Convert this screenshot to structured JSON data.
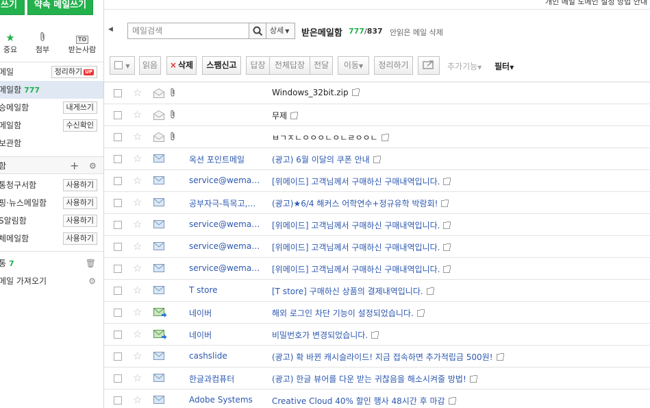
{
  "sidebar": {
    "compose_a": "쓰기",
    "compose_b": "약속 메일쓰기",
    "quick": [
      {
        "label": "중요",
        "icon": "star-icon"
      },
      {
        "label": "첨부",
        "icon": "paperclip-icon"
      },
      {
        "label": "받는사람",
        "icon": "to-icon",
        "icon_text": "TO"
      }
    ],
    "items": [
      {
        "label": "메일",
        "button": "정리하기",
        "badge": "UP"
      },
      {
        "label": "메일함",
        "count": "777"
      },
      {
        "label": "승메일함",
        "button": "내게쓰기"
      },
      {
        "label": "메일함",
        "button": "수신확인"
      },
      {
        "label": "보관함"
      }
    ],
    "folder_header": "함",
    "folders": [
      {
        "label": "통청구서함",
        "button": "사용하기"
      },
      {
        "label": "핑·뉴스메일함",
        "button": "사용하기"
      },
      {
        "label": "S알림함",
        "button": "사용하기"
      },
      {
        "label": "체메일함",
        "button": "사용하기"
      }
    ],
    "trash": {
      "label": "통",
      "count": "7"
    },
    "import": "메일 가져오기"
  },
  "top_strip_text": "개인 메일 도메인 설정 방법 안내",
  "header": {
    "search_placeholder": "메일검색",
    "detail": "상세",
    "title": "받은메일함",
    "unread": "777",
    "total": "837",
    "delete_unread": "안읽은 메일 삭제"
  },
  "toolbar": {
    "read": "읽음",
    "delete": "삭제",
    "spam": "스팸신고",
    "reply": "답장",
    "reply_all": "전체답장",
    "forward": "전달",
    "move": "이동",
    "organize": "정리하기",
    "more": "추가기능",
    "filter": "필터"
  },
  "mails": [
    {
      "sender": "",
      "subject": "Windows_32bit.zip",
      "icon": "envelope-open",
      "attach": true,
      "dark": true
    },
    {
      "sender": "",
      "subject": "무제",
      "icon": "envelope-open",
      "attach": true,
      "dark": true
    },
    {
      "sender": "",
      "subject": "ㅂㄱㅈㄴㅇㅇㅇㄴㅇㄴㄹㅇㅇㄴ",
      "icon": "envelope-open",
      "attach": true,
      "dark": true
    },
    {
      "sender": "옥션 포인트메일",
      "subject": "(광고) 6월 이달의 쿠폰 안내",
      "icon": "envelope"
    },
    {
      "sender": "service@wemade…",
      "subject": "[위메이드] 고객님께서 구매하신 구매내역입니다.",
      "icon": "envelope"
    },
    {
      "sender": "공부자극-특목고,…",
      "subject": "(광고)★6/4 해커스 어학연수+정규유학 박람회!",
      "icon": "envelope"
    },
    {
      "sender": "service@wemade…",
      "subject": "[위메이드] 고객님께서 구매하신 구매내역입니다.",
      "icon": "envelope"
    },
    {
      "sender": "service@wemade…",
      "subject": "[위메이드] 고객님께서 구매하신 구매내역입니다.",
      "icon": "envelope"
    },
    {
      "sender": "service@wemade…",
      "subject": "[위메이드] 고객님께서 구매하신 구매내역입니다.",
      "icon": "envelope"
    },
    {
      "sender": "T store",
      "subject": "[T store] 구매하신 상품의 결제내역입니다.",
      "icon": "envelope"
    },
    {
      "sender": "네이버",
      "subject": "해외 로그인 차단 기능이 설정되었습니다.",
      "icon": "envelope-green"
    },
    {
      "sender": "네이버",
      "subject": "비밀번호가 변경되었습니다.",
      "icon": "envelope-green"
    },
    {
      "sender": "cashslide",
      "subject": "(광고) 확 바뀐 캐시슬라이드! 지금 접속하면 추가적립금 500원!",
      "icon": "envelope"
    },
    {
      "sender": "한글과컴퓨터",
      "subject": "(광고) 한글 뷰어를 다운 받는 귀찮음을 해소시켜줄 방법!",
      "icon": "envelope"
    },
    {
      "sender": "Adobe Systems",
      "subject": "Creative Cloud 40% 할인 행사 48시간 후 마감",
      "icon": "envelope"
    }
  ],
  "colors": {
    "accent": "#23b14d",
    "link": "#2b57b0",
    "selected": "#dfe8f3"
  }
}
